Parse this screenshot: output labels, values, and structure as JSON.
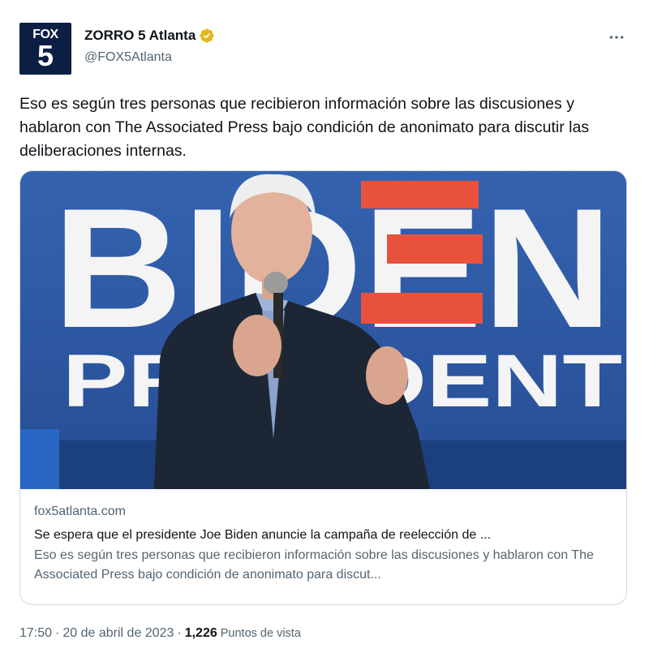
{
  "author": {
    "avatar_text_top": "FOX",
    "avatar_text_bottom": "5",
    "display_name": "ZORRO 5 Atlanta",
    "handle": "@FOX5Atlanta",
    "verified_badge_color": "#e2b719"
  },
  "more_icon": "more-horizontal-icon",
  "tweet": {
    "text": "Eso es según tres personas que recibieron información sobre las discusiones y hablaron con The Associated Press bajo condición de anonimato para discutir las deliberaciones internas."
  },
  "card": {
    "image_sign_top": "BIDEN",
    "image_sign_bottom": "PRESIDENT",
    "domain": "fox5atlanta.com",
    "title": "Se espera que el presidente Joe Biden anuncie la campaña de reelección de ...",
    "description": "Eso es según tres personas que recibieron información sobre las discusiones y hablaron con The Associated Press bajo condición de anonimato para discut..."
  },
  "footer": {
    "time": "17:50",
    "separator": "·",
    "date": "20 de abril de 2023",
    "views_count": "1,226",
    "views_label": "Puntos de vista"
  },
  "colors": {
    "text": "#0f1419",
    "secondary": "#536471",
    "border": "#cfd9de",
    "fox_navy": "#0b1f44",
    "sign_blue": "#2f5aa8",
    "sign_red": "#e8523c"
  }
}
